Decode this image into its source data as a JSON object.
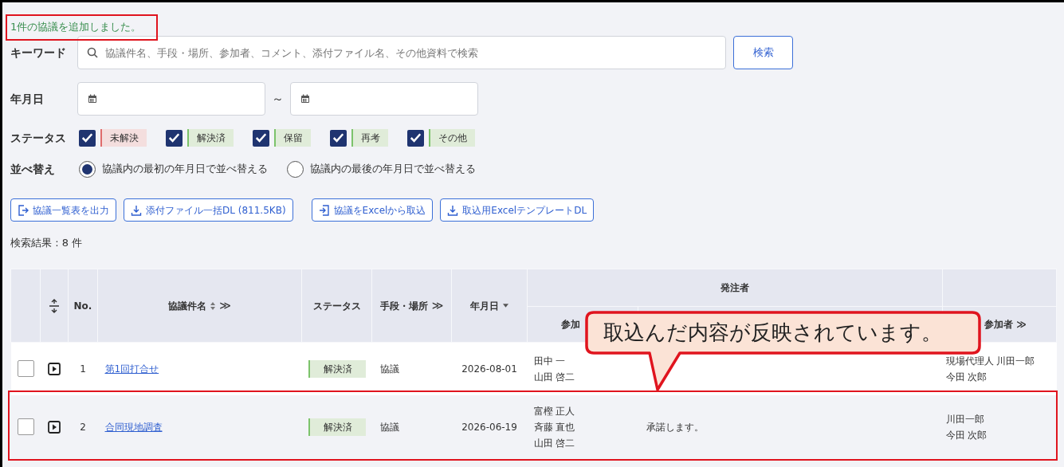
{
  "message": "1件の協議を追加しました。",
  "keyword": {
    "label": "キーワード",
    "placeholder": "協議件名、手段・場所、参加者、コメント、添付ファイル名、その他資料で検索",
    "button": "検索"
  },
  "date": {
    "label": "年月日",
    "separator": "～"
  },
  "status_filter": {
    "label": "ステータス",
    "options": [
      {
        "label": "未解決",
        "checked": true,
        "color": "#e06c6c"
      },
      {
        "label": "解決済",
        "checked": true,
        "color": "#7cc36b"
      },
      {
        "label": "保留",
        "checked": true,
        "color": "#7cc36b"
      },
      {
        "label": "再考",
        "checked": true,
        "color": "#7cc36b"
      },
      {
        "label": "その他",
        "checked": true,
        "color": "#7cc36b"
      }
    ]
  },
  "sort": {
    "label": "並べ替え",
    "options": [
      {
        "label": "協議内の最初の年月日で並べ替える",
        "selected": true
      },
      {
        "label": "協議内の最後の年月日で並べ替える",
        "selected": false
      }
    ]
  },
  "actions": [
    {
      "label": "協議一覧表を出力",
      "kind": "export"
    },
    {
      "label": "添付ファイル一括DL (811.5KB)",
      "kind": "download"
    },
    {
      "label": "協議をExcelから取込",
      "kind": "import"
    },
    {
      "label": "取込用ExcelテンプレートDL",
      "kind": "download"
    }
  ],
  "result_count": "検索結果 : 8 件",
  "table": {
    "columns": [
      {
        "label": "No."
      },
      {
        "label": "協議件名",
        "sortable": true,
        "more": "≫"
      },
      {
        "label": "ステータス"
      },
      {
        "label": "手段・場所",
        "more": "≫"
      },
      {
        "label": "年月日",
        "sortable": true,
        "descending": true
      }
    ],
    "group": {
      "label": "発注者",
      "sub": "参加"
    },
    "group_2": {
      "sub": "参加者",
      "more": "≫"
    },
    "rows": [
      {
        "checked": false,
        "no": "1",
        "name": "第1回打合せ",
        "status": "解決済",
        "method": "協議",
        "date": "2026-08-01",
        "orderer": [
          "田中 一",
          "山田 啓二"
        ],
        "contractor": [
          "現場代理人 川田一郎",
          "今田 次郎"
        ],
        "highlighted": false
      },
      {
        "checked": false,
        "no": "2",
        "name": "合同現地調査",
        "status": "解決済",
        "method": "協議",
        "date": "2026-06-19",
        "orderer": [
          "富樫 正人",
          "斉藤 直也",
          "山田 啓二"
        ],
        "comment": "承諾します。",
        "contractor": [
          "川田一郎",
          "今田 次郎"
        ],
        "highlighted": true
      }
    ]
  },
  "callout": "取込んだ内容が反映されています。"
}
